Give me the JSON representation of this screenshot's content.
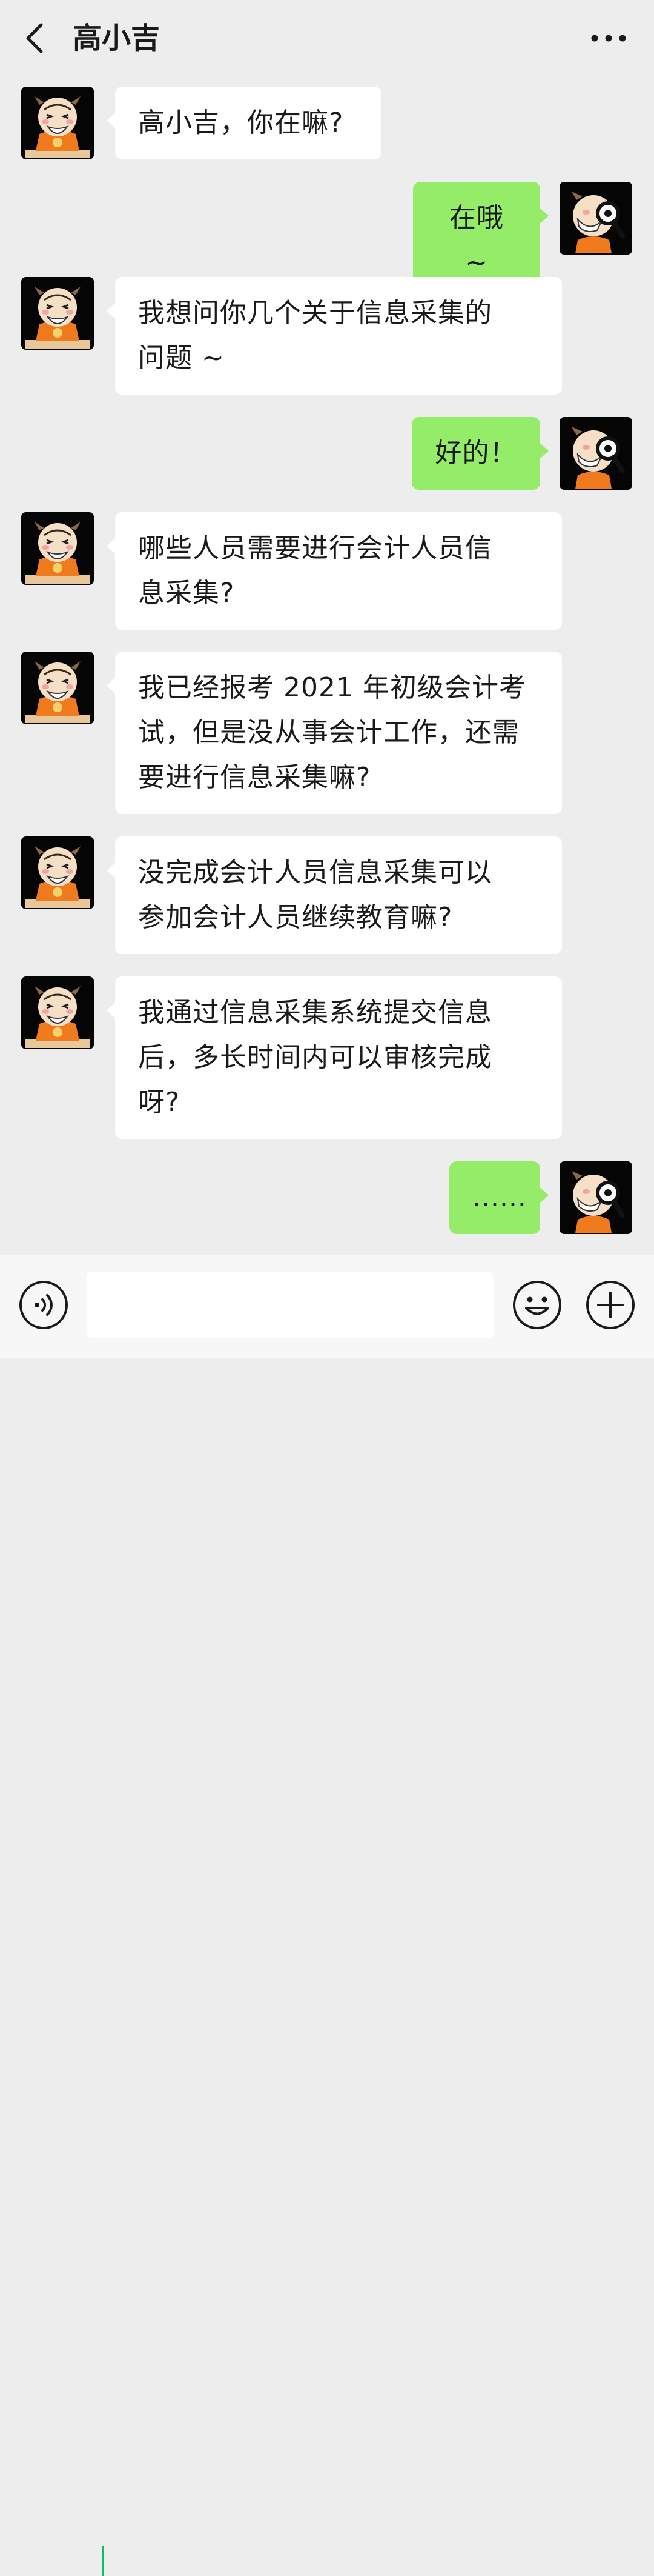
{
  "header": {
    "title": "高小吉"
  },
  "icons": {
    "back": "chevron-left-icon",
    "more": "ellipsis-icon",
    "voice": "voice-icon",
    "emoji": "smiley-icon",
    "plus": "plus-icon"
  },
  "colors": {
    "background": "#ededed",
    "incoming_bubble": "#ffffff",
    "outgoing_bubble": "#95ec69",
    "caret": "#07c160",
    "avatar_background": "#050505"
  },
  "messages": [
    {
      "side": "in",
      "lines": [
        "高小吉，你在嘛?"
      ]
    },
    {
      "side": "out",
      "lines": [
        "在哦 ~"
      ]
    },
    {
      "side": "in",
      "lines": [
        "我想问你几个关于信息采集的",
        "问题 ~"
      ]
    },
    {
      "side": "out",
      "lines": [
        "好的！"
      ]
    },
    {
      "side": "in",
      "lines": [
        "哪些人员需要进行会计人员信",
        "息采集?"
      ]
    },
    {
      "side": "in",
      "lines": [
        "我已经报考 2021 年初级会计考",
        "试，但是没从事会计工作，还需",
        "要进行信息采集嘛?"
      ]
    },
    {
      "side": "in",
      "lines": [
        "没完成会计人员信息采集可以",
        "参加会计人员继续教育嘛?"
      ]
    },
    {
      "side": "in",
      "lines": [
        "我通过信息采集系统提交信息",
        "后，多长时间内可以审核完成",
        "呀?"
      ]
    },
    {
      "side": "out",
      "lines": [
        "......"
      ]
    }
  ],
  "input": {
    "value": ""
  }
}
